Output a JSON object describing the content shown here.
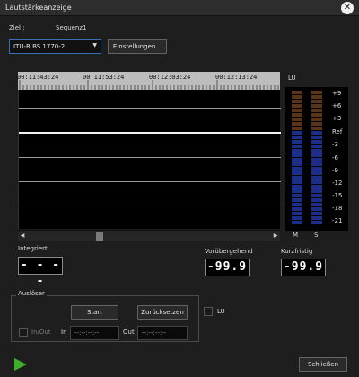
{
  "window": {
    "title": "Lautstärkeanzeige",
    "close_glyph": "✕"
  },
  "target": {
    "label": "Ziel :",
    "value": "Sequenz1"
  },
  "standard": {
    "selected": "ITU-R BS.1770-2",
    "caret": "▼"
  },
  "settings_button": "Einstellungen...",
  "timeline": {
    "ticks": [
      "00:11:43:24",
      "00:11:53:24",
      "00:12:03:24",
      "00:12:13:24"
    ]
  },
  "scrollbar": {
    "left_arrow": "◀",
    "right_arrow": "▶"
  },
  "meter": {
    "unit": "LU",
    "scale": [
      "+9",
      "+6",
      "+3",
      "Ref",
      "-3",
      "-6",
      "-9",
      "-12",
      "-15",
      "-18",
      "-21"
    ],
    "channels": [
      "M",
      "S"
    ],
    "colors": {
      "upper": "#5a3418",
      "lower": "#1c2f88"
    }
  },
  "readouts": {
    "integrated": {
      "label": "Integriert",
      "value": "- - - -"
    },
    "momentary": {
      "label": "Vorübergehend",
      "value": "-99.9"
    },
    "short_term": {
      "label": "Kurzfristig",
      "value": "-99.9"
    }
  },
  "trigger": {
    "label": "Auslöser",
    "start_button": "Start",
    "reset_button": "Zurücksetzen",
    "inout_label": "In/Out",
    "in_label": "In",
    "out_label": "Out",
    "in_value": "--:--:--:--",
    "out_value": "--:--:--:--"
  },
  "lu_checkbox_label": "LU",
  "close_button": "Schließen",
  "accent_colors": {
    "play": "#3fae2a",
    "select_border": "#3c6fb4"
  }
}
